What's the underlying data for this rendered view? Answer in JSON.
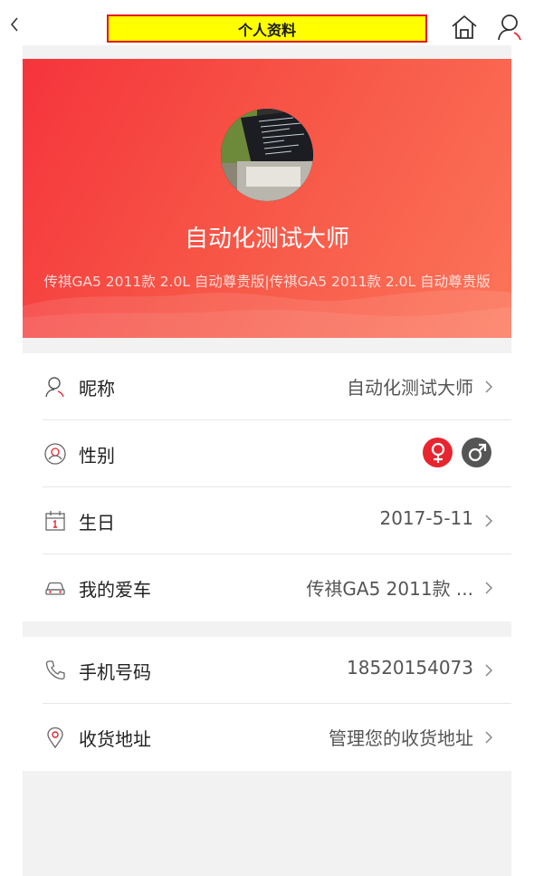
{
  "header": {
    "title": "个人资料",
    "icons": [
      "back-icon",
      "home-icon",
      "user-icon"
    ]
  },
  "profile": {
    "nickname": "自动化测试大师",
    "car_line": "传祺GA5 2011款 2.0L 自动尊贵版|传祺GA5 2011款 2.0L 自动尊贵版"
  },
  "info": {
    "nickname": {
      "label": "昵称",
      "value": "自动化测试大师"
    },
    "gender": {
      "label": "性别",
      "female_symbol": "♀",
      "male_symbol": "♂"
    },
    "birthday": {
      "label": "生日",
      "value": "2017-5-11"
    },
    "car": {
      "label": "我的爱车",
      "value": "传祺GA5 2011款 ..."
    }
  },
  "contact": {
    "phone": {
      "label": "手机号码",
      "value": "18520154073"
    },
    "address": {
      "label": "收货地址",
      "value": "管理您的收货地址"
    }
  },
  "colors": {
    "accent": "#e8242f",
    "title_highlight": "#ffff00",
    "banner_start": "#f5343c",
    "banner_end": "#fc7559",
    "male_badge": "#555555"
  }
}
